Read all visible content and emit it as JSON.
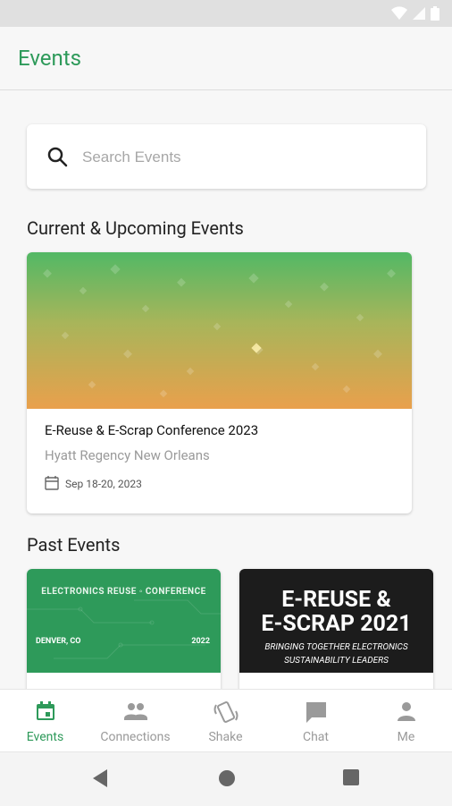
{
  "app": {
    "title": "Events"
  },
  "search": {
    "placeholder": "Search Events"
  },
  "sections": {
    "current_title": "Current & Upcoming Events",
    "past_title": "Past Events"
  },
  "current_event": {
    "name": "E-Reuse & E-Scrap Conference 2023",
    "venue": "Hyatt Regency New Orleans",
    "date": "Sep 18-20, 2023"
  },
  "past_events": [
    {
      "header": "ELECTRONICS REUSE ◦ CONFERENCE",
      "city": "DENVER, CO",
      "year": "2022"
    },
    {
      "title_line1": "E-REUSE &",
      "title_line2": "E-SCRAP 2021",
      "tagline_line1": "BRINGING TOGETHER ELECTRONICS",
      "tagline_line2": "SUSTAINABILITY LEADERS"
    }
  ],
  "bottom_nav": [
    {
      "label": "Events",
      "icon": "calendar-icon",
      "active": true
    },
    {
      "label": "Connections",
      "icon": "people-icon",
      "active": false
    },
    {
      "label": "Shake",
      "icon": "phone-shake-icon",
      "active": false
    },
    {
      "label": "Chat",
      "icon": "chat-icon",
      "active": false
    },
    {
      "label": "Me",
      "icon": "person-icon",
      "active": false
    }
  ],
  "colors": {
    "accent": "#2e9a5a",
    "inactive": "#9a9a9a",
    "banner_green": "#2e9a5a",
    "banner_dark": "#1c1c1c"
  }
}
